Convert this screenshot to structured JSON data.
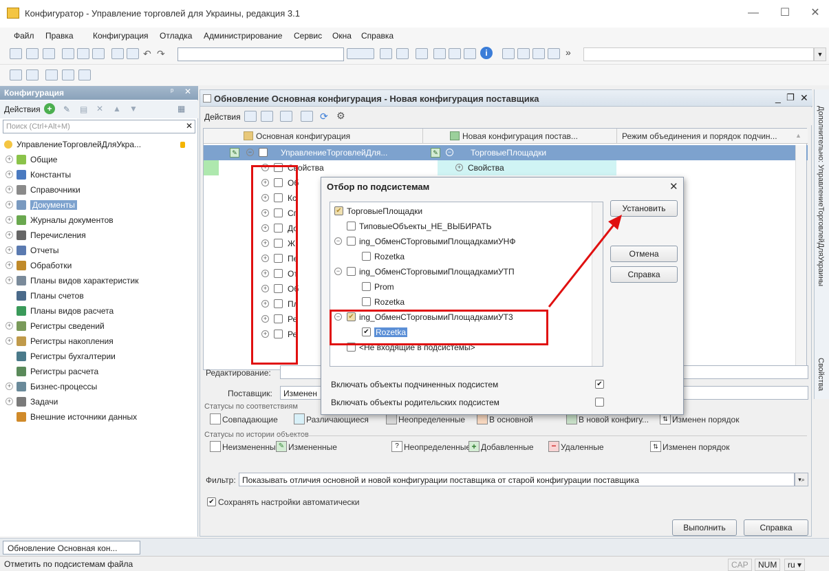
{
  "window": {
    "title": "Конфигуратор - Управление торговлей для Украины, редакция 3.1"
  },
  "menu": [
    "Файл",
    "Правка",
    "Конфигурация",
    "Отладка",
    "Администрирование",
    "Сервис",
    "Окна",
    "Справка"
  ],
  "config_panel": {
    "title": "Конфигурация",
    "actions_label": "Действия",
    "search_placeholder": "Поиск (Ctrl+Alt+M)",
    "root": "УправлениеТорговлейДляУкра...",
    "items": [
      {
        "label": "Общие",
        "expandable": true
      },
      {
        "label": "Константы",
        "expandable": true
      },
      {
        "label": "Справочники",
        "expandable": true
      },
      {
        "label": "Документы",
        "expandable": true,
        "selected": true
      },
      {
        "label": "Журналы документов",
        "expandable": true
      },
      {
        "label": "Перечисления",
        "expandable": true
      },
      {
        "label": "Отчеты",
        "expandable": true
      },
      {
        "label": "Обработки",
        "expandable": true
      },
      {
        "label": "Планы видов характеристик",
        "expandable": true
      },
      {
        "label": "Планы счетов",
        "expandable": false
      },
      {
        "label": "Планы видов расчета",
        "expandable": false
      },
      {
        "label": "Регистры сведений",
        "expandable": true
      },
      {
        "label": "Регистры накопления",
        "expandable": true
      },
      {
        "label": "Регистры бухгалтерии",
        "expandable": false
      },
      {
        "label": "Регистры расчета",
        "expandable": false
      },
      {
        "label": "Бизнес-процессы",
        "expandable": true
      },
      {
        "label": "Задачи",
        "expandable": true
      },
      {
        "label": "Внешние источники данных",
        "expandable": false
      }
    ]
  },
  "doc": {
    "title": "Обновление Основная конфигурация - Новая конфигурация поставщика",
    "actions_label": "Действия",
    "columns": [
      "Основная конфигурация",
      "Новая конфигурация постав...",
      "Режим объединения и порядок подчин..."
    ],
    "rows": [
      {
        "main": "УправлениеТорговлейДля...",
        "new": "ТорговыеПлощадки"
      },
      {
        "main": "Свойства",
        "new": "Свойства"
      },
      {
        "main": "Об",
        "new": ""
      },
      {
        "main": "Кс",
        "new": ""
      },
      {
        "main": "Сп",
        "new": ""
      },
      {
        "main": "До",
        "new": ""
      },
      {
        "main": "Ж",
        "new": ""
      },
      {
        "main": "Пе",
        "new": ""
      },
      {
        "main": "От",
        "new": ""
      },
      {
        "main": "Об",
        "new": ""
      },
      {
        "main": "Пл",
        "new": ""
      },
      {
        "main": "Ре",
        "new": ""
      },
      {
        "main": "Ре",
        "new": ""
      }
    ],
    "editing_label": "Редактирование:",
    "supplier_label": "Поставщик:",
    "supplier_value": "Изменен",
    "status_match_title": "Статусы по соответствиям",
    "status_match": [
      {
        "label": "Совпадающие",
        "color": "#ffffff"
      },
      {
        "label": "Различающиеся",
        "color": "#d8f0f8"
      },
      {
        "label": "Неопределенные",
        "color": "#d8d8d8"
      },
      {
        "label": "В основной",
        "color": "#f8d8c0"
      },
      {
        "label": "В новой конфигу...",
        "color": "#c8e0c8"
      },
      {
        "label": "Изменен порядок",
        "color": ""
      }
    ],
    "status_history_title": "Статусы по истории объектов",
    "status_history": [
      "Неизмененные",
      "Измененные",
      "Неопределенные",
      "Добавленные",
      "Удаленные",
      "Изменен порядок"
    ],
    "filter_label": "Фильтр:",
    "filter_value": "Показывать отличия основной и новой конфигурации поставщика от старой конфигурации поставщика",
    "save_settings": "Сохранять настройки автоматически",
    "run_button": "Выполнить",
    "help_button": "Справка"
  },
  "side_tabs": [
    "Дополнительно: УправлениеТорговлейДляУкраины",
    "Свойства"
  ],
  "dialog": {
    "title": "Отбор по подсистемам",
    "tree": [
      {
        "label": "ТорговыеПлощадки",
        "level": 0,
        "checked": "partial",
        "expander": false
      },
      {
        "label": "ТиповыеОбъекты_НЕ_ВЫБИРАТЬ",
        "level": 1,
        "checked": "no",
        "expander": false
      },
      {
        "label": "ing_ОбменСТорговымиПлощадкамиУНФ",
        "level": 1,
        "checked": "no",
        "expander": true
      },
      {
        "label": "Rozetka",
        "level": 2,
        "checked": "no",
        "expander": false
      },
      {
        "label": "ing_ОбменСТорговымиПлощадкамиУТП",
        "level": 1,
        "checked": "no",
        "expander": true
      },
      {
        "label": "Prom",
        "level": 2,
        "checked": "no",
        "expander": false
      },
      {
        "label": "Rozetka",
        "level": 2,
        "checked": "no",
        "expander": false
      },
      {
        "label": "ing_ОбменСТорговымиПлощадкамиУТ3",
        "level": 1,
        "checked": "partial",
        "expander": true
      },
      {
        "label": "Rozetka",
        "level": 2,
        "checked": "yes",
        "expander": false,
        "selected": true
      },
      {
        "label": "<Не входящие в подсистемы>",
        "level": 1,
        "checked": "no",
        "expander": false
      }
    ],
    "include_sub": "Включать объекты подчиненных подсистем",
    "include_sub_checked": true,
    "include_parent": "Включать объекты родительских подсистем",
    "include_parent_checked": false,
    "buttons": {
      "set": "Установить",
      "cancel": "Отмена",
      "help": "Справка"
    }
  },
  "taskbar": {
    "item": "Обновление Основная кон..."
  },
  "status": {
    "text": "Отметить по подсистемам файла",
    "cap": "CAP",
    "num": "NUM",
    "lang": "ru"
  }
}
